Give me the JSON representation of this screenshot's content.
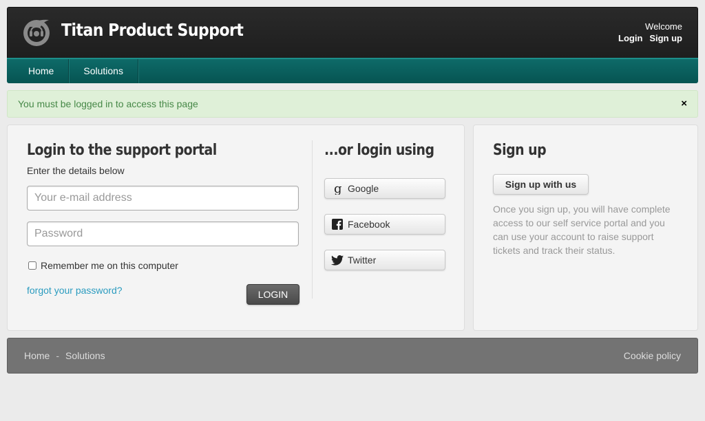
{
  "header": {
    "brand": "Titan Product Support",
    "welcome": "Welcome",
    "login_link": "Login",
    "signup_link": "Sign up"
  },
  "nav": {
    "items": [
      {
        "label": "Home"
      },
      {
        "label": "Solutions"
      }
    ]
  },
  "alert": {
    "message": "You must be logged in to access this page",
    "close": "×"
  },
  "login_panel": {
    "title": "Login to the support portal",
    "subtitle": "Enter the details below",
    "email_placeholder": "Your e-mail address",
    "password_placeholder": "Password",
    "remember_label": "Remember me on this computer",
    "forgot_link": "forgot your password?",
    "login_button": "LOGIN"
  },
  "social_panel": {
    "title": "...or login using",
    "providers": [
      {
        "label": "Google",
        "icon": "google-icon"
      },
      {
        "label": "Facebook",
        "icon": "facebook-icon"
      },
      {
        "label": "Twitter",
        "icon": "twitter-icon"
      }
    ]
  },
  "signup_panel": {
    "title": "Sign up",
    "button": "Sign up with us",
    "description": "Once you sign up, you will have complete access to our self service portal and you can use your account to raise support tickets and track their status."
  },
  "footer": {
    "links": [
      {
        "label": "Home"
      },
      {
        "label": "Solutions"
      }
    ],
    "separator": "-",
    "cookie_policy": "Cookie policy"
  },
  "colors": {
    "header_bg": "#222222",
    "nav_bg": "#065452",
    "alert_bg": "#dff0d8",
    "alert_text": "#468847",
    "link": "#2a9bbf",
    "footer_bg": "#737373"
  }
}
